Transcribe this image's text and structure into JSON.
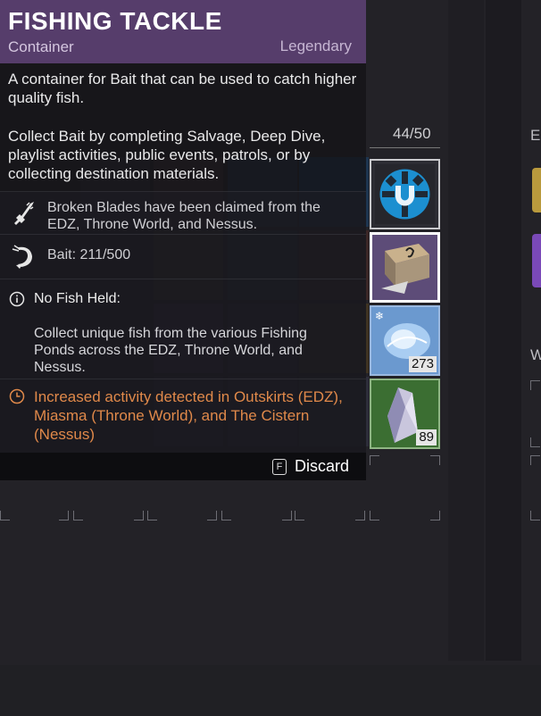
{
  "item": {
    "title": "FISHING TACKLE",
    "type": "Container",
    "rarity": "Legendary",
    "description_1": "A container for Bait that can be used to catch higher quality fish.",
    "description_2": "Collect Bait by completing Salvage, Deep Dive, playlist activities, public events, patrols, or by collecting destination materials.",
    "perks": [
      {
        "icon": "broken-blade-icon",
        "text": "Broken Blades have been claimed from the EDZ, Throne World, and Nessus."
      },
      {
        "icon": "shrimp-bait-icon",
        "text": "Bait: 211/500"
      }
    ],
    "fish_header": "No Fish Held:",
    "fish_text": "Collect unique fish from the various Fishing Ponds across the EDZ, Throne World, and Nessus.",
    "alert_text": "Increased activity detected in Outskirts (EDZ), Miasma (Throne World), and The Cistern (Nessus)",
    "alert_color": "#e0894a",
    "footer": {
      "key": "F",
      "action": "Discard"
    },
    "header_color": "#563d6b"
  },
  "inventory": {
    "counter": "44/50",
    "slots": [
      {
        "name": "blue-emblem-slot",
        "icon": "blue-seal-icon",
        "qty": ""
      },
      {
        "name": "tackle-box-slot",
        "icon": "tackle-box-icon",
        "qty": ""
      },
      {
        "name": "ice-crystal-slot",
        "icon": "frozen-fish-icon",
        "qty": "273"
      },
      {
        "name": "crystal-shard-slot",
        "icon": "crystal-shard-icon",
        "qty": "89"
      }
    ],
    "side_letters": [
      "E",
      "W"
    ]
  }
}
